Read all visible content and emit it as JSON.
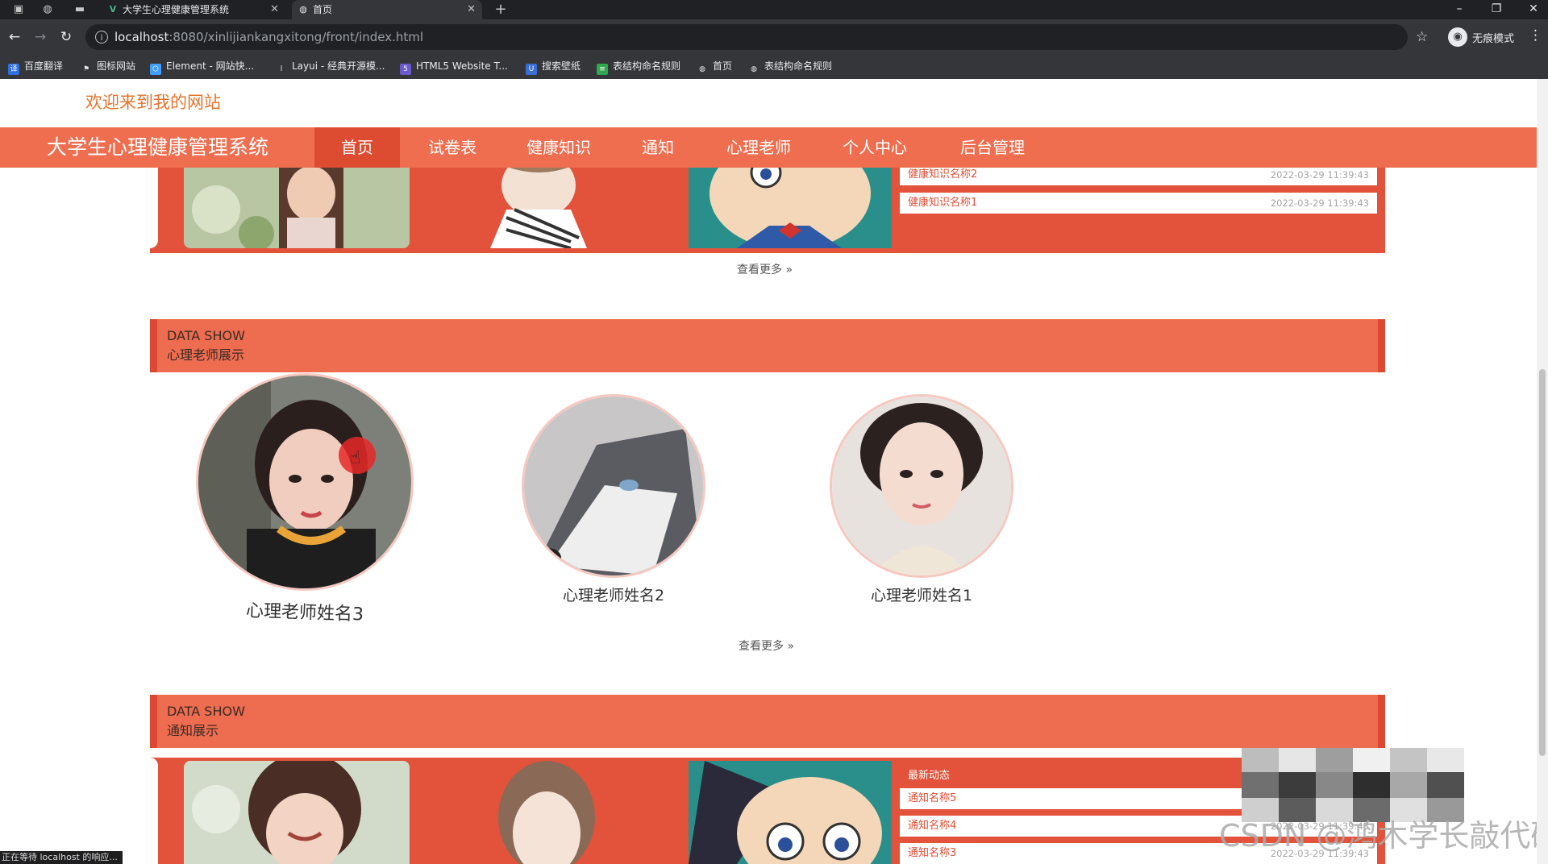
{
  "browser": {
    "tabs": [
      {
        "title": "大学生心理健康管理系统",
        "active": false
      },
      {
        "title": "首页",
        "active": true
      }
    ],
    "url_host": "localhost",
    "url_path": ":8080/xinlijiankangxitong/front/index.html",
    "incognito_label": "无痕模式",
    "bookmarks": [
      "百度翻译",
      "图标网站",
      "Element - 网站快...",
      "Layui - 经典开源模...",
      "HTML5 Website T...",
      "搜索壁纸",
      "表结构命名规则",
      "首页",
      "表结构命名规则"
    ],
    "status_text": "正在等待 localhost 的响应..."
  },
  "header": {
    "welcome": "欢迎来到我的网站",
    "brand": "大学生心理健康管理系统",
    "nav": [
      "首页",
      "试卷表",
      "健康知识",
      "通知",
      "心理老师",
      "个人中心",
      "后台管理"
    ],
    "active_nav": "首页"
  },
  "knowledge": {
    "items": [
      {
        "name": "健康知识名称2",
        "time": "2022-03-29 11:39:43"
      },
      {
        "name": "健康知识名称1",
        "time": "2022-03-29 11:39:43"
      }
    ],
    "more": "查看更多"
  },
  "teachers": {
    "title_en": "DATA SHOW",
    "title_cn": "心理老师展示",
    "items": [
      {
        "name": "心理老师姓名3"
      },
      {
        "name": "心理老师姓名2"
      },
      {
        "name": "心理老师姓名1"
      }
    ],
    "more": "查看更多"
  },
  "notices": {
    "title_en": "DATA SHOW",
    "title_cn": "通知展示",
    "latest_label": "最新动态",
    "items": [
      {
        "name": "通知名称5",
        "time": ""
      },
      {
        "name": "通知名称4",
        "time": "2022-03-29 11:39:43"
      },
      {
        "name": "通知名称3",
        "time": "2022-03-29 11:39:43"
      }
    ]
  },
  "watermark": "CSDN @鸿木学长敲代码",
  "colors": {
    "accent": "#ef6e50",
    "accent_dark": "#dd4b31",
    "panel": "#e3523a",
    "welcome": "#e3752f"
  }
}
